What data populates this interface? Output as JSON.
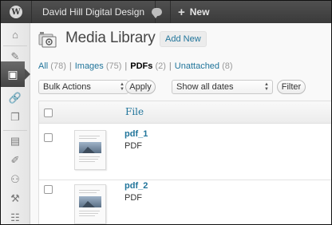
{
  "adminbar": {
    "logo_glyph": "W",
    "site_name": "David Hill Digital Design",
    "new_label": "New",
    "new_glyph": "+"
  },
  "sidebar": {
    "items": [
      {
        "name": "dashboard-icon",
        "glyph": "⌂"
      },
      {
        "name": "posts-icon",
        "glyph": "✎"
      },
      {
        "name": "media-icon",
        "glyph": "▣",
        "active": true
      },
      {
        "name": "links-icon",
        "glyph": "🔗"
      },
      {
        "name": "pages-icon",
        "glyph": "❐"
      },
      {
        "name": "comments-icon",
        "glyph": "▤"
      },
      {
        "name": "appearance-icon",
        "glyph": "✐"
      },
      {
        "name": "users-icon",
        "glyph": "⚇"
      },
      {
        "name": "tools-icon",
        "glyph": "⚒"
      },
      {
        "name": "settings-icon",
        "glyph": "☷"
      }
    ]
  },
  "page": {
    "title": "Media Library",
    "add_new": "Add New"
  },
  "filters": [
    {
      "label": "All",
      "count": "(78)"
    },
    {
      "label": "Images",
      "count": "(75)"
    },
    {
      "label": "PDFs",
      "count": "(2)",
      "current": true
    },
    {
      "label": "Unattached",
      "count": "(8)"
    }
  ],
  "filter_separator": "|",
  "actions": {
    "bulk_actions": "Bulk Actions",
    "apply": "Apply",
    "dates": "Show all dates",
    "filter": "Filter"
  },
  "table": {
    "file_header": "File",
    "rows": [
      {
        "name": "pdf_1",
        "type": "PDF"
      },
      {
        "name": "pdf_2",
        "type": "PDF"
      }
    ]
  },
  "colors": {
    "link": "#21759b",
    "adminbar": "#464646",
    "sidebar_active": "#555555"
  }
}
